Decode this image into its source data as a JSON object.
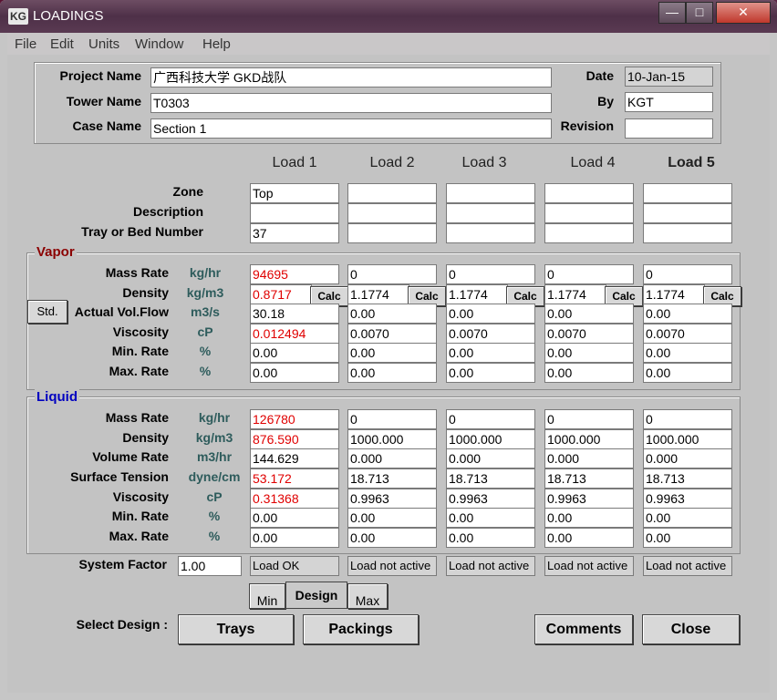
{
  "window": {
    "title": "LOADINGS",
    "icon": "KG",
    "min_glyph": "—",
    "max_glyph": "□",
    "close_glyph": "✕"
  },
  "menu": [
    "File",
    "Edit",
    "Units",
    "Window",
    "Help"
  ],
  "project": {
    "project_name_label": "Project Name",
    "project_name": "广西科技大学 GKD战队",
    "tower_name_label": "Tower Name",
    "tower_name": "T0303",
    "case_name_label": "Case Name",
    "case_name": "Section  1",
    "date_label": "Date",
    "date": "10-Jan-15",
    "by_label": "By",
    "by": "KGT",
    "revision_label": "Revision",
    "revision": ""
  },
  "loads": [
    "Load 1",
    "Load 2",
    "Load 3",
    "Load 4",
    "Load 5"
  ],
  "info": {
    "labels": [
      "Zone",
      "Description",
      "Tray or Bed Number"
    ],
    "zone": [
      "Top",
      "",
      "",
      "",
      ""
    ],
    "description": [
      "",
      "",
      "",
      "",
      ""
    ],
    "tray": [
      "37",
      "",
      "",
      "",
      ""
    ]
  },
  "vapor": {
    "title": "Vapor",
    "std_button": "Std.",
    "calc_label": "Calc",
    "rows": [
      {
        "label": "Mass Rate",
        "unit": "kg/hr",
        "values": [
          "94695",
          "0",
          "0",
          "0",
          "0"
        ],
        "red": true
      },
      {
        "label": "Density",
        "unit": "kg/m3",
        "values": [
          "0.8717",
          "1.1774",
          "1.1774",
          "1.1774",
          "1.1774"
        ],
        "red": true
      },
      {
        "label": "Actual Vol.Flow",
        "unit": "m3/s",
        "values": [
          "30.18",
          "0.00",
          "0.00",
          "0.00",
          "0.00"
        ],
        "red": false
      },
      {
        "label": "Viscosity",
        "unit": "cP",
        "values": [
          "0.012494",
          "0.0070",
          "0.0070",
          "0.0070",
          "0.0070"
        ],
        "red": true
      },
      {
        "label": "Min. Rate",
        "unit": "%",
        "values": [
          "0.00",
          "0.00",
          "0.00",
          "0.00",
          "0.00"
        ],
        "red": false
      },
      {
        "label": "Max. Rate",
        "unit": "%",
        "values": [
          "0.00",
          "0.00",
          "0.00",
          "0.00",
          "0.00"
        ],
        "red": false
      }
    ]
  },
  "liquid": {
    "title": "Liquid",
    "rows": [
      {
        "label": "Mass Rate",
        "unit": "kg/hr",
        "values": [
          "126780",
          "0",
          "0",
          "0",
          "0"
        ],
        "red": true
      },
      {
        "label": "Density",
        "unit": "kg/m3",
        "values": [
          "876.590",
          "1000.000",
          "1000.000",
          "1000.000",
          "1000.000"
        ],
        "red": true
      },
      {
        "label": "Volume Rate",
        "unit": "m3/hr",
        "values": [
          "144.629",
          "0.000",
          "0.000",
          "0.000",
          "0.000"
        ],
        "red": false
      },
      {
        "label": "Surface Tension",
        "unit": "dyne/cm",
        "values": [
          "53.172",
          "18.713",
          "18.713",
          "18.713",
          "18.713"
        ],
        "red": true
      },
      {
        "label": "Viscosity",
        "unit": "cP",
        "values": [
          "0.31368",
          "0.9963",
          "0.9963",
          "0.9963",
          "0.9963"
        ],
        "red": true
      },
      {
        "label": "Min. Rate",
        "unit": "%",
        "values": [
          "0.00",
          "0.00",
          "0.00",
          "0.00",
          "0.00"
        ],
        "red": false
      },
      {
        "label": "Max. Rate",
        "unit": "%",
        "values": [
          "0.00",
          "0.00",
          "0.00",
          "0.00",
          "0.00"
        ],
        "red": false
      }
    ]
  },
  "system_factor": {
    "label": "System Factor",
    "value": "1.00"
  },
  "status": [
    "Load OK",
    "Load not active",
    "Load not active",
    "Load not active",
    "Load not active"
  ],
  "mode_tabs": [
    "Min",
    "Design",
    "Max"
  ],
  "select_design": {
    "label": "Select Design :",
    "trays": "Trays",
    "packings": "Packings"
  },
  "comments_button": "Comments",
  "close_button": "Close",
  "colors": {
    "red": "#e00000",
    "vapor_title": "#8b0000",
    "liquid_title": "#0000c0",
    "unit": "#2e5c5c"
  }
}
